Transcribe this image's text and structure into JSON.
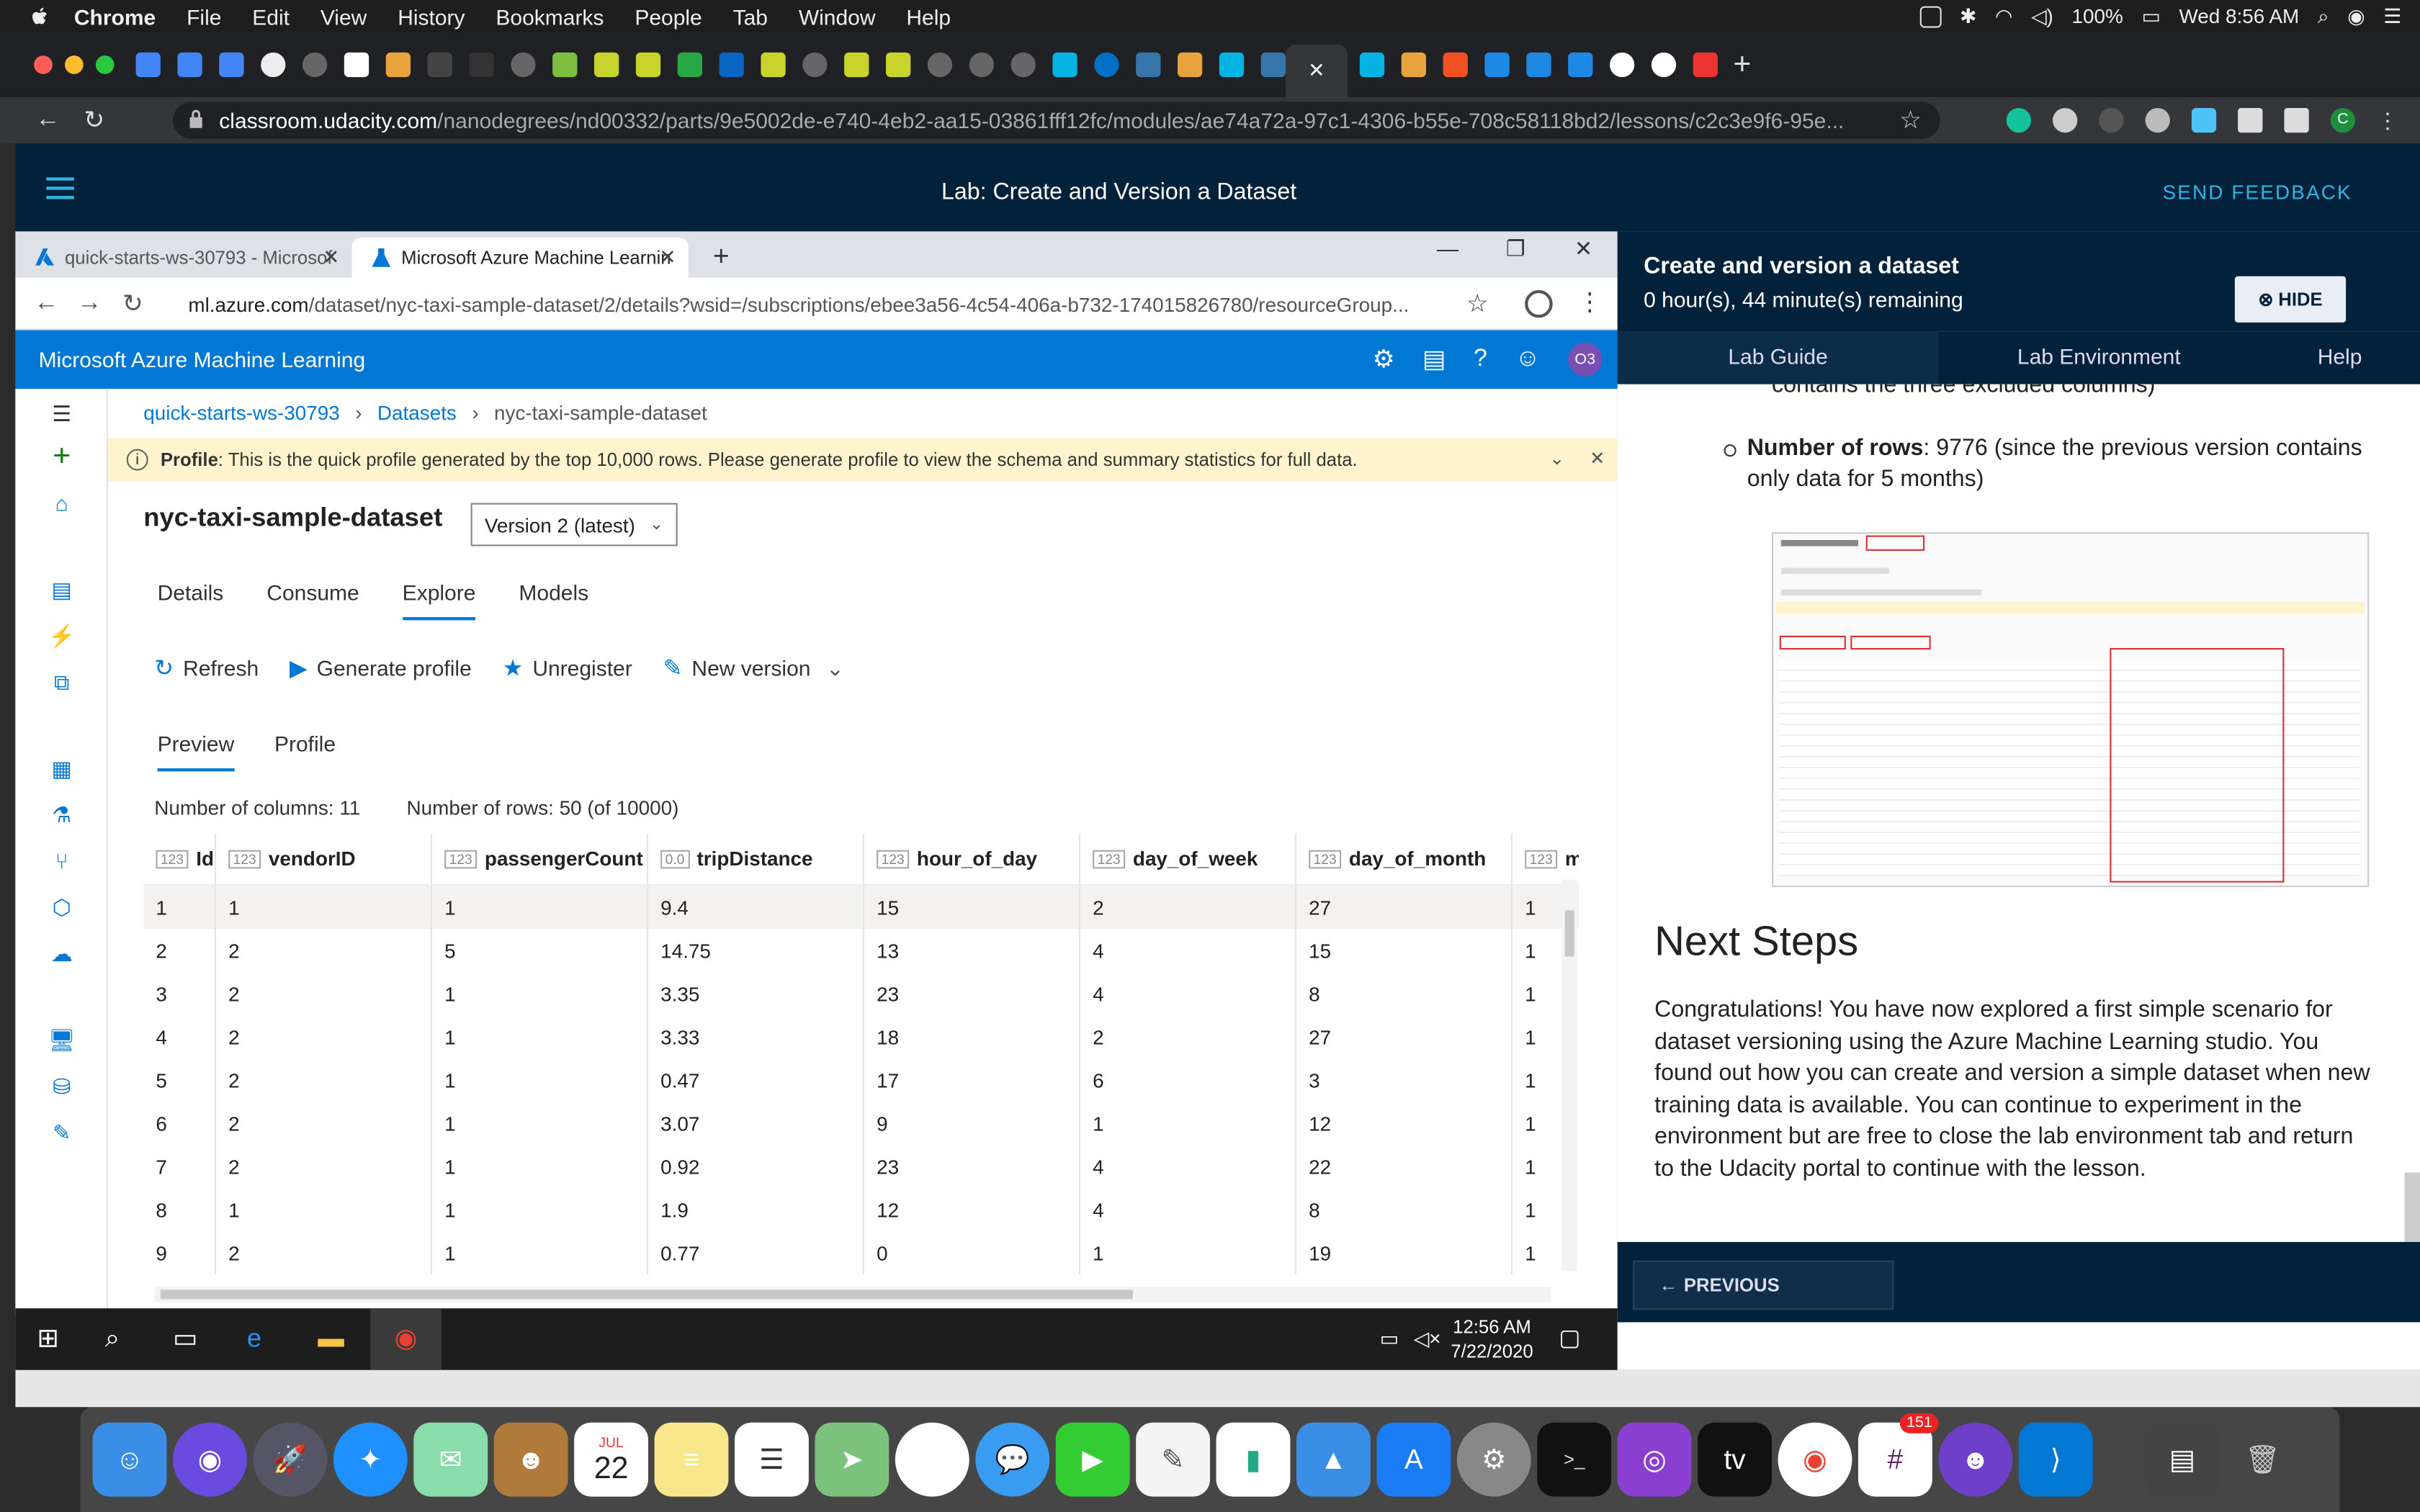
{
  "menubar": {
    "items": [
      "Chrome",
      "File",
      "Edit",
      "View",
      "History",
      "Bookmarks",
      "People",
      "Tab",
      "Window",
      "Help"
    ],
    "right": {
      "battery": "100%",
      "datetime": "Wed 8:56 AM"
    }
  },
  "outer_browser": {
    "url_host": "classroom.udacity.com",
    "url_path": "/nanodegrees/nd00332/parts/9e5002de-e740-4eb2-aa15-03861fff12fc/modules/ae74a72a-97c1-4306-b55e-708c58118bd2/lessons/c2c3e9f6-95e...",
    "profile_initial": "C"
  },
  "udacity_header": {
    "title": "Lab: Create and Version a Dataset",
    "send_feedback": "SEND FEEDBACK"
  },
  "inner_browser": {
    "tab1": "quick-starts-ws-30793 - Microsof",
    "tab2": "Microsoft Azure Machine Learnin",
    "url_host": "ml.azure.com",
    "url_path": "/dataset/nyc-taxi-sample-dataset/2/details?wsid=/subscriptions/ebee3a56-4c54-406a-b732-174015826780/resourceGroup..."
  },
  "azure": {
    "app_title": "Microsoft Azure Machine Learning",
    "avatar": "O3",
    "breadcrumbs": [
      "quick-starts-ws-30793",
      "Datasets",
      "nyc-taxi-sample-dataset"
    ],
    "profile_label": "Profile",
    "profile_notice": ": This is the quick profile generated by the top 10,000 rows. Please generate profile to view the schema and summary statistics for full data.",
    "dataset_name": "nyc-taxi-sample-dataset",
    "version_select": "Version 2 (latest)",
    "pivots": [
      "Details",
      "Consume",
      "Explore",
      "Models"
    ],
    "commands": {
      "refresh": "Refresh",
      "generate": "Generate profile",
      "unregister": "Unregister",
      "new_version": "New version"
    },
    "subpivots": [
      "Preview",
      "Profile"
    ],
    "num_columns_label": "Number of columns:",
    "num_columns": "11",
    "num_rows_label": "Number of rows:",
    "num_rows": "50 (of 10000)",
    "grid": {
      "columns": [
        {
          "tag": "123",
          "name": "Id"
        },
        {
          "tag": "123",
          "name": "vendorID"
        },
        {
          "tag": "123",
          "name": "passengerCount"
        },
        {
          "tag": "0.0",
          "name": "tripDistance"
        },
        {
          "tag": "123",
          "name": "hour_of_day"
        },
        {
          "tag": "123",
          "name": "day_of_week"
        },
        {
          "tag": "123",
          "name": "day_of_month"
        },
        {
          "tag": "123",
          "name": "m"
        }
      ],
      "rows": [
        [
          "1",
          "1",
          "1",
          "9.4",
          "15",
          "2",
          "27",
          "1"
        ],
        [
          "2",
          "2",
          "5",
          "14.75",
          "13",
          "4",
          "15",
          "1"
        ],
        [
          "3",
          "2",
          "1",
          "3.35",
          "23",
          "4",
          "8",
          "1"
        ],
        [
          "4",
          "2",
          "1",
          "3.33",
          "18",
          "2",
          "27",
          "1"
        ],
        [
          "5",
          "2",
          "1",
          "0.47",
          "17",
          "6",
          "3",
          "1"
        ],
        [
          "6",
          "2",
          "1",
          "3.07",
          "9",
          "1",
          "12",
          "1"
        ],
        [
          "7",
          "2",
          "1",
          "0.92",
          "23",
          "4",
          "22",
          "1"
        ],
        [
          "8",
          "1",
          "1",
          "1.9",
          "12",
          "4",
          "8",
          "1"
        ],
        [
          "9",
          "2",
          "1",
          "0.77",
          "0",
          "1",
          "19",
          "1"
        ]
      ]
    }
  },
  "windows_taskbar": {
    "time": "12:56 AM",
    "date": "7/22/2020"
  },
  "lab_panel": {
    "title": "Create and version a dataset",
    "remaining": "0 hour(s), 44 minute(s) remaining",
    "hide": "HIDE",
    "tabs": [
      "Lab Guide",
      "Lab Environment",
      "Help"
    ],
    "cut_text": "contains the three excluded columns)",
    "bullet_label": "Number of rows",
    "bullet_text": ": 9776 (since the previous version contains only data for 5 months)",
    "next_steps_heading": "Next Steps",
    "next_steps_text": "Congratulations! You have now explored a first simple scenario for dataset versioning using the Azure Machine Learning studio. You found out how you can create and version a simple dataset when new training data is available. You can continue to experiment in the environment but are free to close the lab environment tab and return to the Udacity portal to continue with the lesson.",
    "previous": "PREVIOUS"
  },
  "dock": {
    "calendar_month": "JUL",
    "calendar_day": "22",
    "slack_badge": "151"
  },
  "colors": {
    "azure_blue": "#0078d4",
    "udacity_navy": "#02213a",
    "udacity_accent": "#33b5e5",
    "notice_yellow": "#fff4ce"
  }
}
